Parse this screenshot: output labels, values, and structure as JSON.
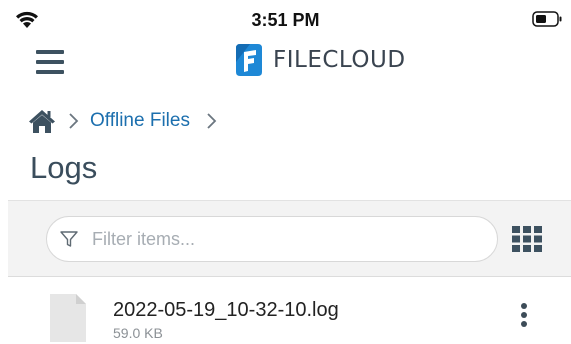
{
  "status_bar": {
    "time": "3:51 PM"
  },
  "brand": {
    "name": "FILECLOUD",
    "accent": "#1c6fae"
  },
  "breadcrumb": {
    "items": [
      "Offline Files"
    ]
  },
  "page": {
    "title": "Logs"
  },
  "filter": {
    "placeholder": "Filter items..."
  },
  "files": [
    {
      "name": "2022-05-19_10-32-10.log",
      "size": "59.0 KB"
    }
  ]
}
